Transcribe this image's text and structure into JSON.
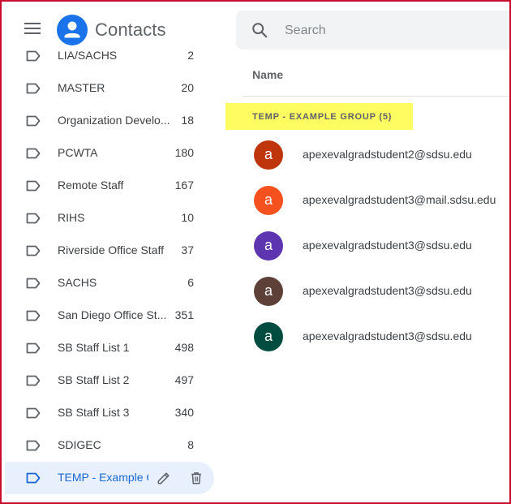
{
  "header": {
    "app_title": "Contacts",
    "menu_icon": "hamburger-menu-icon",
    "logo_icon": "contacts-person-icon",
    "search": {
      "placeholder": "Search",
      "value": ""
    }
  },
  "sidebar": {
    "labels": [
      {
        "name": "LIA/SACHS",
        "count": "2"
      },
      {
        "name": "MASTER",
        "count": "20"
      },
      {
        "name": "Organization Develo...",
        "count": "18"
      },
      {
        "name": "PCWTA",
        "count": "180"
      },
      {
        "name": "Remote Staff",
        "count": "167"
      },
      {
        "name": "RIHS",
        "count": "10"
      },
      {
        "name": "Riverside Office Staff",
        "count": "37"
      },
      {
        "name": "SACHS",
        "count": "6"
      },
      {
        "name": "San Diego Office St...",
        "count": "351"
      },
      {
        "name": "SB Staff List 1",
        "count": "498"
      },
      {
        "name": "SB Staff List 2",
        "count": "497"
      },
      {
        "name": "SB Staff List 3",
        "count": "340"
      },
      {
        "name": "SDIGEC",
        "count": "8"
      }
    ],
    "active_label": {
      "name": "TEMP - Example Group",
      "edit_icon": "pencil-edit-icon",
      "delete_icon": "trash-icon"
    }
  },
  "main": {
    "column_header": "Name",
    "group_title": "TEMP - EXAMPLE GROUP (5)",
    "contacts": [
      {
        "initial": "a",
        "email": "apexevalgradstudent2@sdsu.edu",
        "color": "#bf360c"
      },
      {
        "initial": "a",
        "email": "apexevalgradstudent3@mail.sdsu.edu",
        "color": "#f4511e"
      },
      {
        "initial": "a",
        "email": "apexevalgradstudent3@sdsu.edu",
        "color": "#5e35b1"
      },
      {
        "initial": "a",
        "email": "apexevalgradstudent3@sdsu.edu",
        "color": "#5d4037"
      },
      {
        "initial": "a",
        "email": "apexevalgradstudent3@sdsu.edu",
        "color": "#004d40"
      }
    ]
  },
  "colors": {
    "accent": "#1a73e8",
    "highlight": "#fdfc61",
    "frame_border": "#c8102e",
    "active_bg": "#e8f0fe"
  }
}
